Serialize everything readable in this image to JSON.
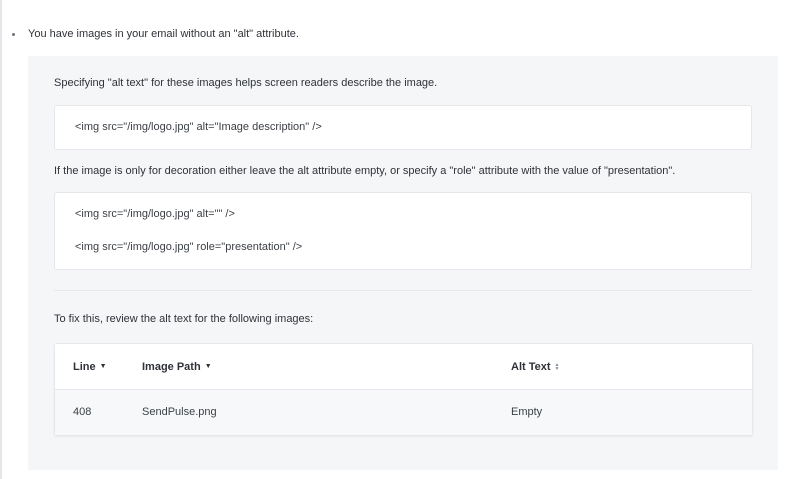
{
  "issue": {
    "text": "You have images in your email without an \"alt\" attribute."
  },
  "panel": {
    "intro": "Specifying \"alt text\" for these images helps screen readers describe the image.",
    "example_code": "<img src=\"/img/logo.jpg\" alt=\"Image description\" />",
    "decoration_note": "If the image is only for decoration either leave the alt attribute empty, or specify a \"role\" attribute with the value of \"presentation\".",
    "decoration_code": [
      "<img src=\"/img/logo.jpg\" alt=\"\" />",
      "<img src=\"/img/logo.jpg\" role=\"presentation\" />"
    ],
    "fix_note": "To fix this, review the alt text for the following images:"
  },
  "table": {
    "columns": {
      "line": "Line",
      "path": "Image Path",
      "alt": "Alt Text"
    },
    "rows": [
      {
        "line": "408",
        "path": "SendPulse.png",
        "alt": "Empty"
      }
    ]
  },
  "colors": {
    "panel_bg": "#f5f6f8",
    "text": "#2f3238",
    "border": "#e5e7eb"
  }
}
